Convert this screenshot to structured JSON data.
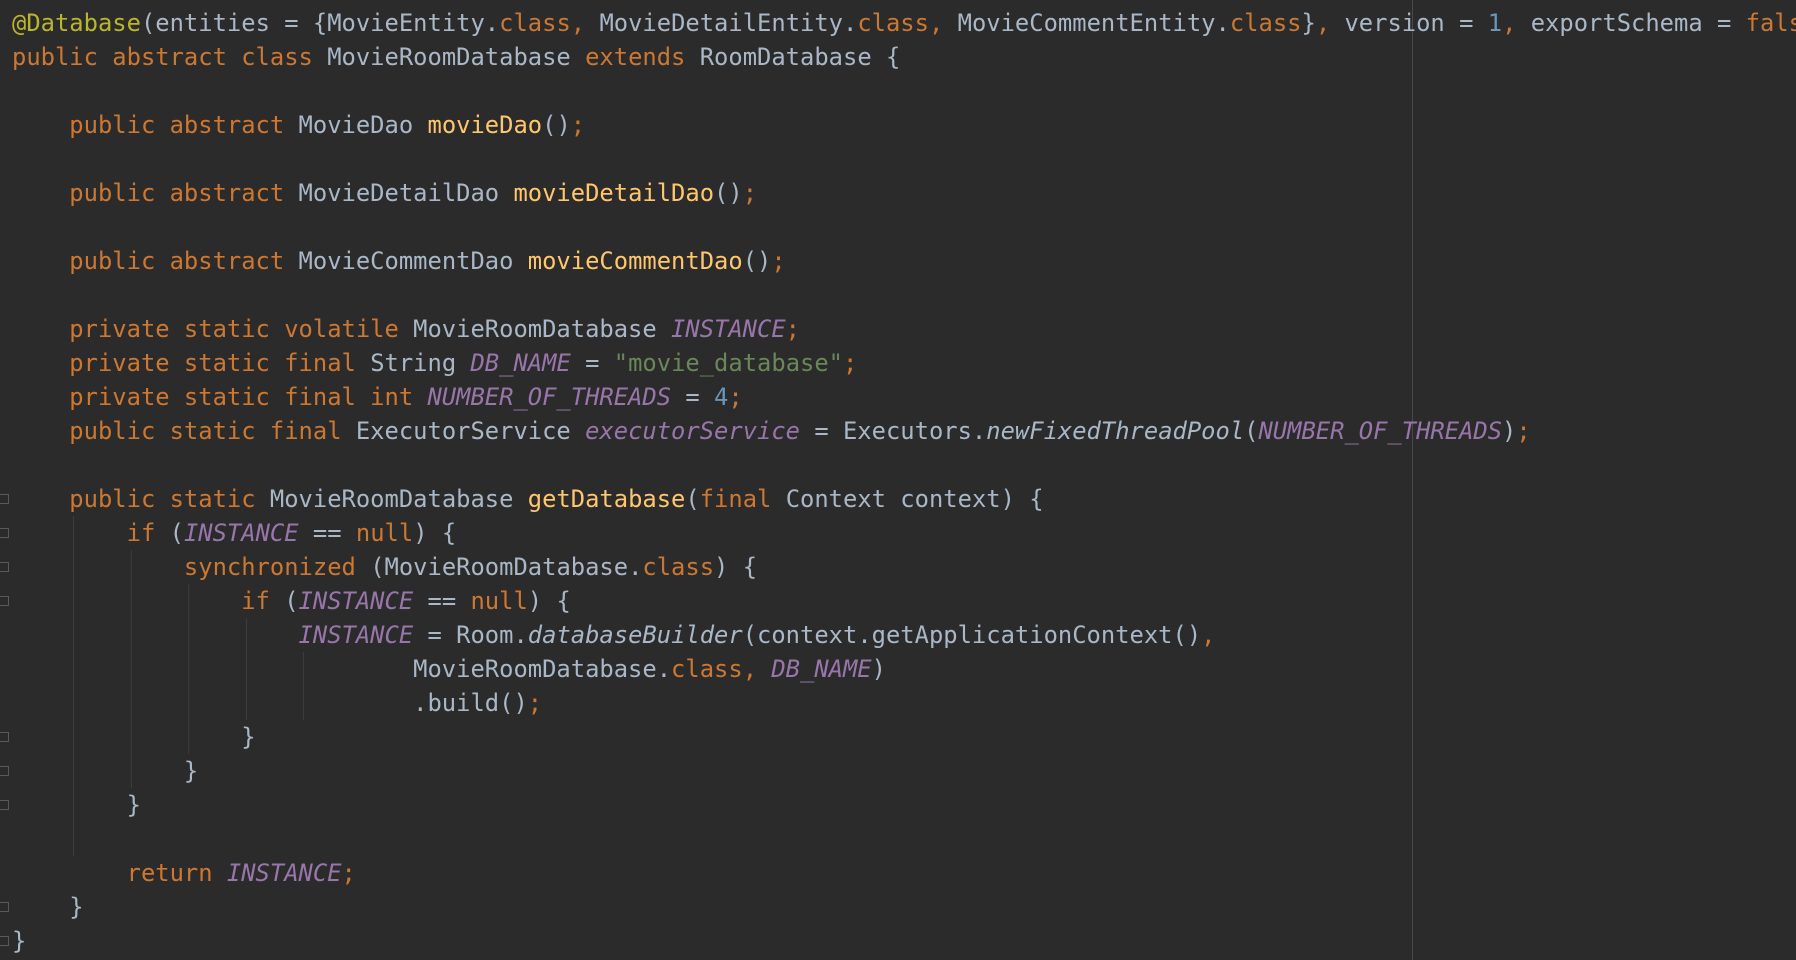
{
  "editor": {
    "language": "java",
    "lines": [
      [
        {
          "t": "@Database",
          "c": "annotation"
        },
        {
          "t": "(entities = {MovieEntity.",
          "c": "text"
        },
        {
          "t": "class",
          "c": "keyword"
        },
        {
          "t": ", ",
          "c": "punct"
        },
        {
          "t": "MovieDetailEntity.",
          "c": "text"
        },
        {
          "t": "class",
          "c": "keyword"
        },
        {
          "t": ", ",
          "c": "punct"
        },
        {
          "t": "MovieCommentEntity.",
          "c": "text"
        },
        {
          "t": "class",
          "c": "keyword"
        },
        {
          "t": "}",
          "c": "text"
        },
        {
          "t": ", ",
          "c": "punct"
        },
        {
          "t": "version = ",
          "c": "text"
        },
        {
          "t": "1",
          "c": "number"
        },
        {
          "t": ", ",
          "c": "punct"
        },
        {
          "t": "exportSchema = ",
          "c": "text"
        },
        {
          "t": "false",
          "c": "keyword"
        },
        {
          "t": ")",
          "c": "text"
        }
      ],
      [
        {
          "t": "public abstract class ",
          "c": "keyword"
        },
        {
          "t": "MovieRoomDatabase ",
          "c": "class"
        },
        {
          "t": "extends ",
          "c": "keyword"
        },
        {
          "t": "RoomDatabase {",
          "c": "text"
        }
      ],
      [],
      [
        {
          "t": "    public abstract ",
          "c": "keyword"
        },
        {
          "t": "MovieDao ",
          "c": "class"
        },
        {
          "t": "movieDao",
          "c": "method"
        },
        {
          "t": "()",
          "c": "text"
        },
        {
          "t": ";",
          "c": "punct"
        }
      ],
      [],
      [
        {
          "t": "    public abstract ",
          "c": "keyword"
        },
        {
          "t": "MovieDetailDao ",
          "c": "class"
        },
        {
          "t": "movieDetailDao",
          "c": "method"
        },
        {
          "t": "()",
          "c": "text"
        },
        {
          "t": ";",
          "c": "punct"
        }
      ],
      [],
      [
        {
          "t": "    public abstract ",
          "c": "keyword"
        },
        {
          "t": "MovieCommentDao ",
          "c": "class"
        },
        {
          "t": "movieCommentDao",
          "c": "method"
        },
        {
          "t": "()",
          "c": "text"
        },
        {
          "t": ";",
          "c": "punct"
        }
      ],
      [],
      [
        {
          "t": "    private static volatile ",
          "c": "keyword"
        },
        {
          "t": "MovieRoomDatabase ",
          "c": "class"
        },
        {
          "t": "INSTANCE",
          "c": "static-field"
        },
        {
          "t": ";",
          "c": "punct"
        }
      ],
      [
        {
          "t": "    private static final ",
          "c": "keyword"
        },
        {
          "t": "String ",
          "c": "class"
        },
        {
          "t": "DB_NAME",
          "c": "static-field"
        },
        {
          "t": " = ",
          "c": "text"
        },
        {
          "t": "\"movie_database\"",
          "c": "string"
        },
        {
          "t": ";",
          "c": "punct"
        }
      ],
      [
        {
          "t": "    private static final int ",
          "c": "keyword"
        },
        {
          "t": "NUMBER_OF_THREADS",
          "c": "static-field"
        },
        {
          "t": " = ",
          "c": "text"
        },
        {
          "t": "4",
          "c": "number"
        },
        {
          "t": ";",
          "c": "punct"
        }
      ],
      [
        {
          "t": "    public static final ",
          "c": "keyword"
        },
        {
          "t": "ExecutorService ",
          "c": "class"
        },
        {
          "t": "executorService",
          "c": "static-field"
        },
        {
          "t": " = Executors.",
          "c": "text"
        },
        {
          "t": "newFixedThreadPool",
          "c": "static-method"
        },
        {
          "t": "(",
          "c": "text"
        },
        {
          "t": "NUMBER_OF_THREADS",
          "c": "static-field"
        },
        {
          "t": ")",
          "c": "text"
        },
        {
          "t": ";",
          "c": "punct"
        }
      ],
      [],
      [
        {
          "t": "    public static ",
          "c": "keyword"
        },
        {
          "t": "MovieRoomDatabase ",
          "c": "class"
        },
        {
          "t": "getDatabase",
          "c": "method"
        },
        {
          "t": "(",
          "c": "text"
        },
        {
          "t": "final ",
          "c": "keyword"
        },
        {
          "t": "Context context) {",
          "c": "text"
        }
      ],
      [
        {
          "t": "        if ",
          "c": "keyword"
        },
        {
          "t": "(",
          "c": "text"
        },
        {
          "t": "INSTANCE",
          "c": "static-field"
        },
        {
          "t": " == ",
          "c": "text"
        },
        {
          "t": "null",
          "c": "keyword"
        },
        {
          "t": ") {",
          "c": "text"
        }
      ],
      [
        {
          "t": "            synchronized ",
          "c": "keyword"
        },
        {
          "t": "(MovieRoomDatabase.",
          "c": "text"
        },
        {
          "t": "class",
          "c": "keyword"
        },
        {
          "t": ") {",
          "c": "text"
        }
      ],
      [
        {
          "t": "                if ",
          "c": "keyword"
        },
        {
          "t": "(",
          "c": "text"
        },
        {
          "t": "INSTANCE",
          "c": "static-field"
        },
        {
          "t": " == ",
          "c": "text"
        },
        {
          "t": "null",
          "c": "keyword"
        },
        {
          "t": ") {",
          "c": "text"
        }
      ],
      [
        {
          "t": "                    ",
          "c": "text"
        },
        {
          "t": "INSTANCE",
          "c": "static-field"
        },
        {
          "t": " = Room.",
          "c": "text"
        },
        {
          "t": "databaseBuilder",
          "c": "static-method"
        },
        {
          "t": "(context.getApplicationContext()",
          "c": "text"
        },
        {
          "t": ",",
          "c": "punct"
        }
      ],
      [
        {
          "t": "                            MovieRoomDatabase.",
          "c": "text"
        },
        {
          "t": "class",
          "c": "keyword"
        },
        {
          "t": ", ",
          "c": "punct"
        },
        {
          "t": "DB_NAME",
          "c": "static-field"
        },
        {
          "t": ")",
          "c": "text"
        }
      ],
      [
        {
          "t": "                            .build()",
          "c": "text"
        },
        {
          "t": ";",
          "c": "punct"
        }
      ],
      [
        {
          "t": "                }",
          "c": "text"
        }
      ],
      [
        {
          "t": "            }",
          "c": "text"
        }
      ],
      [
        {
          "t": "        }",
          "c": "text"
        }
      ],
      [],
      [
        {
          "t": "        return ",
          "c": "keyword"
        },
        {
          "t": "INSTANCE",
          "c": "static-field"
        },
        {
          "t": ";",
          "c": "punct"
        }
      ],
      [
        {
          "t": "    }",
          "c": "text"
        }
      ],
      [
        {
          "t": "}",
          "c": "text"
        }
      ]
    ]
  },
  "colors": {
    "background": "#2b2b2b",
    "text": "#a9b7c6",
    "keyword": "#cc7832",
    "annotation": "#bbb529",
    "method": "#ffc66d",
    "static_field": "#9876aa",
    "string": "#6a8759",
    "number": "#6897bb"
  }
}
